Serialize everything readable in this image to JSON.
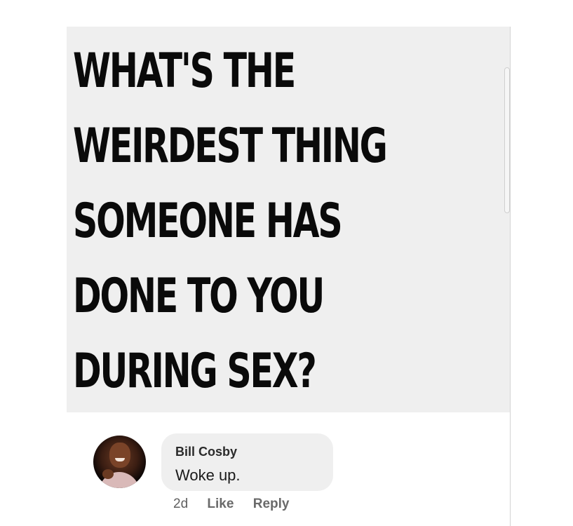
{
  "post": {
    "headline_lines": [
      "WHAT'S THE",
      "WEIRDEST THING",
      "SOMEONE HAS",
      "DONE TO YOU",
      "DURING SEX?"
    ]
  },
  "comment": {
    "author": "Bill Cosby",
    "text": "Woke up.",
    "timestamp": "2d",
    "like_label": "Like",
    "reply_label": "Reply",
    "avatar_icon": "profile-photo"
  },
  "colors": {
    "post_background": "#efefef",
    "headline_text": "#0a0a0a",
    "bubble_background": "#efefef",
    "meta_text": "#606060"
  }
}
